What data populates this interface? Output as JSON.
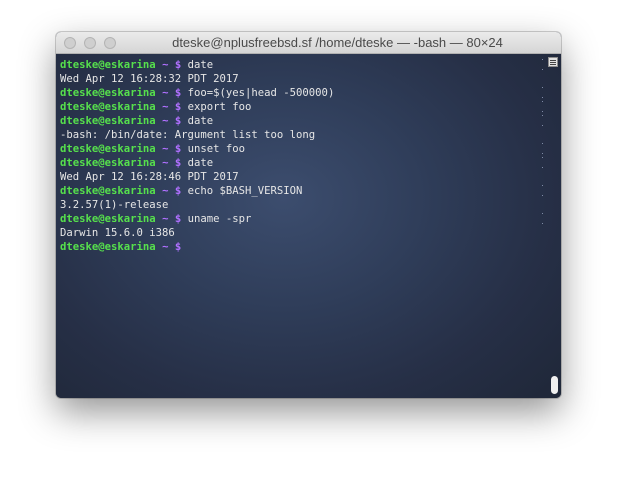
{
  "window": {
    "title": "dteske@nplusfreebsd.sf /home/dteske — -bash — 80×24"
  },
  "prompt": {
    "user_host": "dteske@eskarina",
    "tilde": "~",
    "dollar": "$"
  },
  "lines": [
    {
      "type": "prompt",
      "command": "date",
      "marked": true
    },
    {
      "type": "output",
      "text": "Wed Apr 12 16:28:32 PDT 2017"
    },
    {
      "type": "prompt",
      "command": "foo=$(yes|head -500000)",
      "marked": true
    },
    {
      "type": "prompt",
      "command": "export foo",
      "marked": true
    },
    {
      "type": "prompt",
      "command": "date",
      "marked": true
    },
    {
      "type": "output",
      "text": "-bash: /bin/date: Argument list too long"
    },
    {
      "type": "prompt",
      "command": "unset foo",
      "marked": true
    },
    {
      "type": "prompt",
      "command": "date",
      "marked": true
    },
    {
      "type": "output",
      "text": "Wed Apr 12 16:28:46 PDT 2017"
    },
    {
      "type": "prompt",
      "command": "echo $BASH_VERSION",
      "marked": true
    },
    {
      "type": "output",
      "text": "3.2.57(1)-release"
    },
    {
      "type": "prompt",
      "command": "uname -spr",
      "marked": true
    },
    {
      "type": "output",
      "text": "Darwin 15.6.0 i386"
    },
    {
      "type": "prompt",
      "command": "",
      "marked": false
    }
  ],
  "colors": {
    "prompt_user": "#56e04c",
    "prompt_symbol": "#b070ff",
    "text": "#e6e6e6",
    "background": "#27314a"
  },
  "scroll": {
    "position_fraction": 1.0
  }
}
